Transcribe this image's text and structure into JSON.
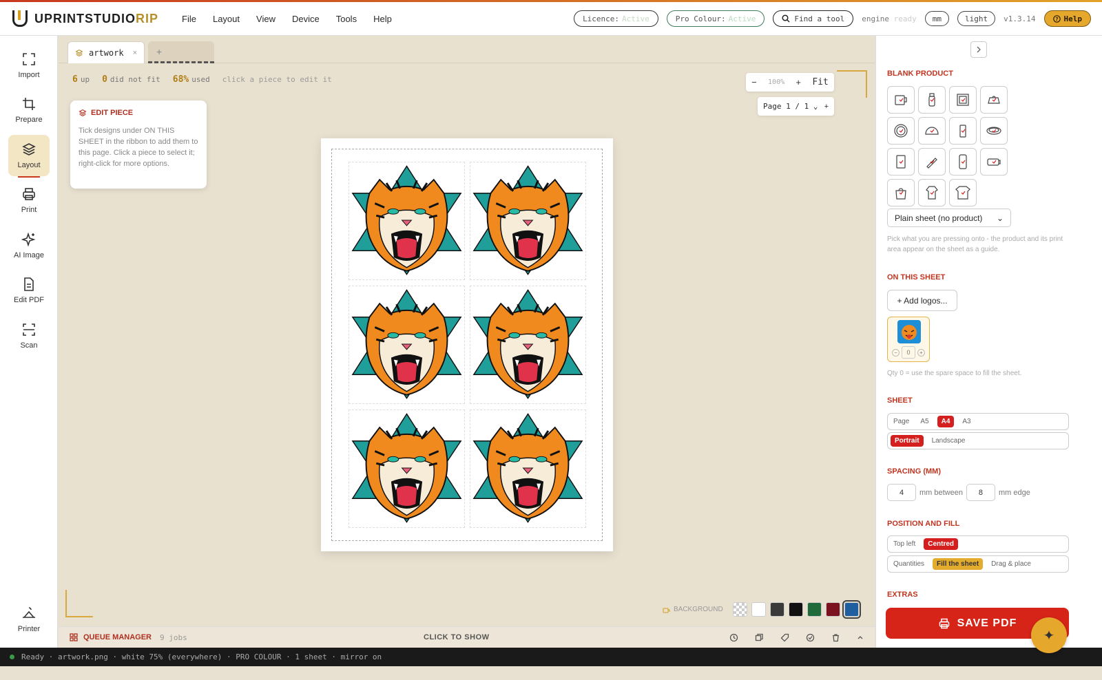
{
  "app": {
    "logo_main": "UPRINTSTUDIO",
    "logo_accent": "RIP"
  },
  "menu": [
    "File",
    "Layout",
    "View",
    "Device",
    "Tools",
    "Help"
  ],
  "topbar": {
    "licence_label": "Licence:",
    "licence_value": "Active",
    "procolour_label": "Pro Colour:",
    "procolour_value": "Active",
    "find": "Find a tool",
    "engine_label": "engine",
    "engine_value": "ready",
    "unit": "mm",
    "theme": "light",
    "version": "v1.3.14",
    "help": "Help"
  },
  "sidebar": {
    "items": [
      {
        "label": "Import",
        "icon": "import-icon"
      },
      {
        "label": "Prepare",
        "icon": "crop-icon"
      },
      {
        "label": "Layout",
        "icon": "layers-icon",
        "active": true
      },
      {
        "label": "Print",
        "icon": "printer-icon"
      },
      {
        "label": "AI Image",
        "icon": "sparkle-icon"
      },
      {
        "label": "Edit PDF",
        "icon": "document-icon"
      },
      {
        "label": "Scan",
        "icon": "scan-icon"
      }
    ],
    "bottom": {
      "label": "Printer",
      "icon": "printer-device-icon"
    }
  },
  "tabs": {
    "active": "artwork",
    "close": "×",
    "add": "+"
  },
  "stats": {
    "up_num": "6",
    "up_label": "up",
    "nofit_num": "0",
    "nofit_label": "did not fit",
    "used_num": "68%",
    "used_label": "used",
    "hint": "click a piece to edit it"
  },
  "edit_piece": {
    "title": "EDIT PIECE",
    "body": "Tick designs under ON THIS SHEET in the ribbon to add them to this page. Click a piece to select it; right-click for more options."
  },
  "zoom": {
    "minus": "−",
    "value": "100%",
    "plus": "+",
    "fit": "Fit"
  },
  "page": {
    "label": "Page",
    "current": "1",
    "sep": "/",
    "total": "1",
    "add": "+"
  },
  "background": {
    "label": "BACKGROUND",
    "swatches": [
      "transparent",
      "#ffffff",
      "#3a3a3a",
      "#111111",
      "#1f6b3c",
      "#7a1220",
      "#1f5fa0"
    ],
    "selected": 6
  },
  "queue": {
    "title": "QUEUE MANAGER",
    "jobs": "9 jobs",
    "show": "CLICK TO SHOW"
  },
  "status": "Ready · artwork.png · white 75% (everywhere) · PRO COLOUR · 1 sheet · mirror on",
  "panel": {
    "blank_title": "BLANK PRODUCT",
    "products": [
      "mug-icon",
      "bottle-icon",
      "frame-icon",
      "bag-icon",
      "plate-icon",
      "cap-icon",
      "tumbler-icon",
      "coaster-icon",
      "phone-case-icon",
      "pen-icon",
      "phone-icon",
      "mug-wide-icon",
      "tote-icon",
      "hoodie-icon",
      "tshirt-icon"
    ],
    "product_select": "Plain sheet (no product)",
    "product_desc": "Pick what you are pressing onto - the product and its print area appear on the sheet as a guide.",
    "on_sheet_title": "ON THIS SHEET",
    "add_logos": "+ Add logos...",
    "qty": "0",
    "qty_desc": "Qty 0 = use the spare space to fill the sheet.",
    "sheet_title": "SHEET",
    "sizes": [
      "Page",
      "A5",
      "A4",
      "A3"
    ],
    "size_selected": "A4",
    "orient": [
      "Portrait",
      "Landscape"
    ],
    "orient_selected": "Portrait",
    "spacing_title": "SPACING (MM)",
    "spacing_between": "4",
    "between_label": "mm between",
    "spacing_edge": "8",
    "edge_label": "mm edge",
    "position_title": "POSITION AND FILL",
    "positions": [
      "Top left",
      "Centred"
    ],
    "position_selected": "Centred",
    "fills": [
      "Quantities",
      "Fill the sheet",
      "Drag & place"
    ],
    "fill_selected": "Fill the sheet",
    "extras_title": "EXTRAS",
    "save": "SAVE PDF"
  },
  "colors": {
    "accent": "#c03520",
    "gold": "#e3ac2e",
    "save": "#d62418"
  }
}
